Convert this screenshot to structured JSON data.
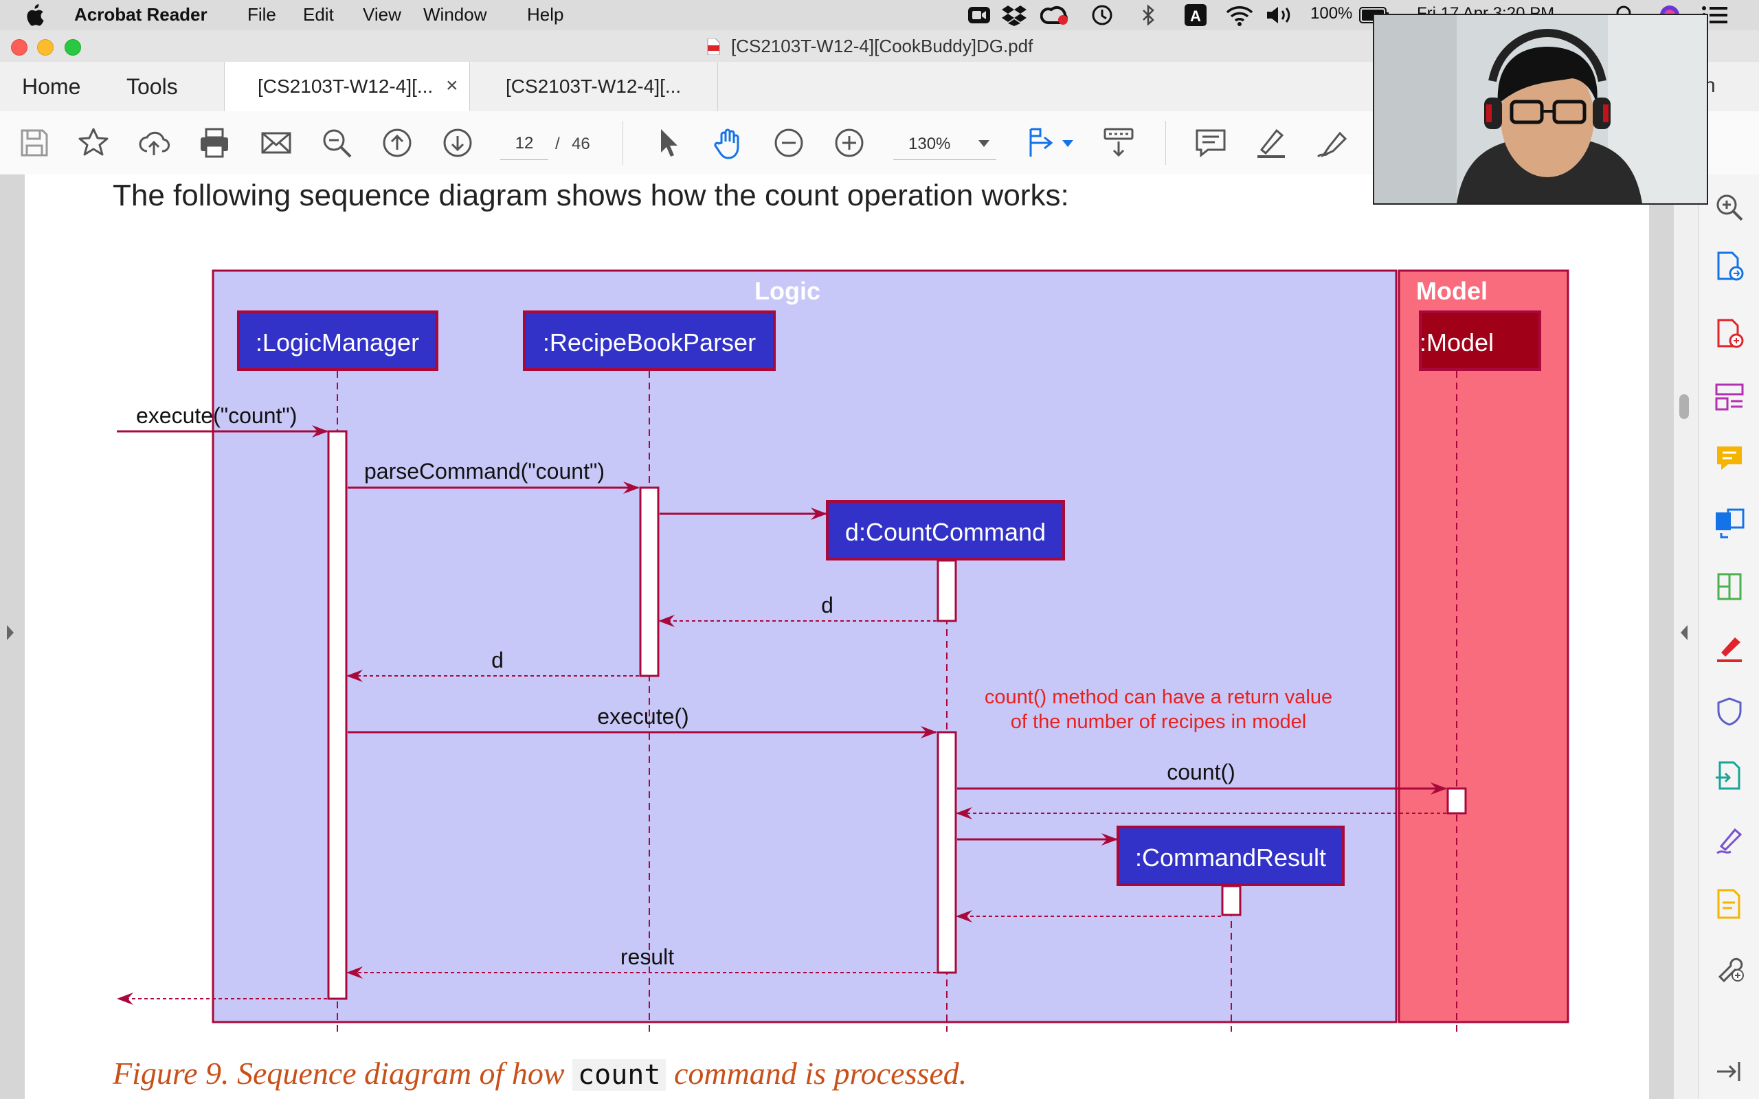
{
  "menubar": {
    "app_name": "Acrobat Reader",
    "items": [
      "File",
      "Edit",
      "View",
      "Window",
      "Help"
    ],
    "battery": "100%",
    "datetime": "Fri 17 Apr  3:20 PM"
  },
  "window": {
    "title": "[CS2103T-W12-4][CookBuddy]DG.pdf"
  },
  "tabs": {
    "home": "Home",
    "tools": "Tools",
    "doc_tab_1": "[CS2103T-W12-4][...",
    "doc_tab_1_close": "×",
    "doc_tab_2": "[CS2103T-W12-4][...",
    "sign_in_partial": "n"
  },
  "toolbar": {
    "current_page": "12",
    "page_separator": "/",
    "total_pages": "46",
    "zoom": "130%"
  },
  "document": {
    "intro": "The following sequence diagram shows how the count operation works:",
    "caption_prefix": "Figure 9. Sequence diagram of how",
    "caption_code": "count",
    "caption_suffix": "command is processed."
  },
  "diagram": {
    "frame_logic": "Logic",
    "frame_model": "Model",
    "participants": {
      "logic_manager": ":LogicManager",
      "parser": ":RecipeBookParser",
      "count_command": "d:CountCommand",
      "model": ":Model",
      "command_result": ":CommandResult"
    },
    "messages": {
      "execute_count": "execute(\"count\")",
      "parse_command": "parseCommand(\"count\")",
      "return_d_1": "d",
      "return_d_2": "d",
      "execute": "execute()",
      "count": "count()",
      "result": "result"
    },
    "note_line_1": "count() method can have a return value",
    "note_line_2": "of the number of recipes in model"
  },
  "colors": {
    "logic_frame_fill": "#c8c8f8",
    "frame_border": "#a8093a",
    "participant_fill": "#3232c8",
    "model_frame_fill": "#f86c7e",
    "model_participant_fill": "#a00018",
    "note_text": "#e8201e",
    "caption_text": "#c8501a",
    "acrobat_blue": "#1473e6",
    "acrobat_red": "#e0242c"
  }
}
